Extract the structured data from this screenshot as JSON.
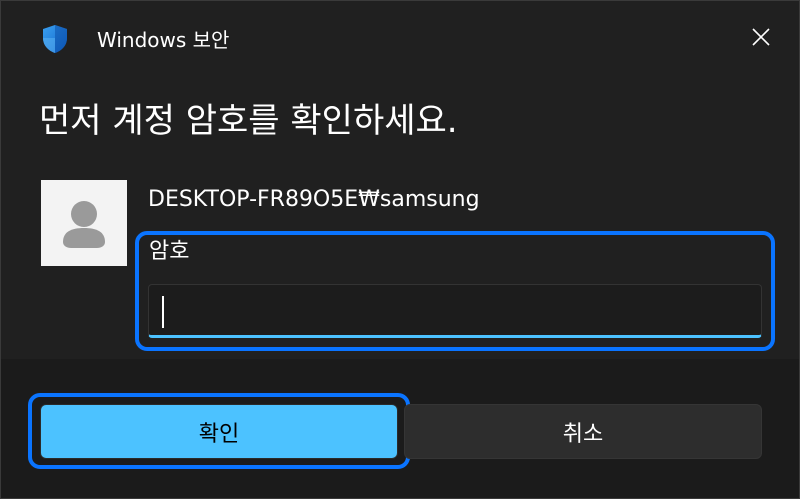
{
  "window": {
    "title": "Windows 보안",
    "app_icon": "shield-icon",
    "close_icon": "close-icon"
  },
  "prompt": {
    "heading": "먼저 계정 암호를 확인하세요."
  },
  "account": {
    "avatar_icon": "user-avatar-icon",
    "name": "DESKTOP-FR89O5E₩samsung"
  },
  "password": {
    "label": "암호",
    "value": "",
    "placeholder": ""
  },
  "buttons": {
    "confirm_label": "확인",
    "cancel_label": "취소"
  },
  "colors": {
    "accent": "#4cc2ff",
    "focus_ring": "#0a74ff",
    "background": "#202020"
  }
}
